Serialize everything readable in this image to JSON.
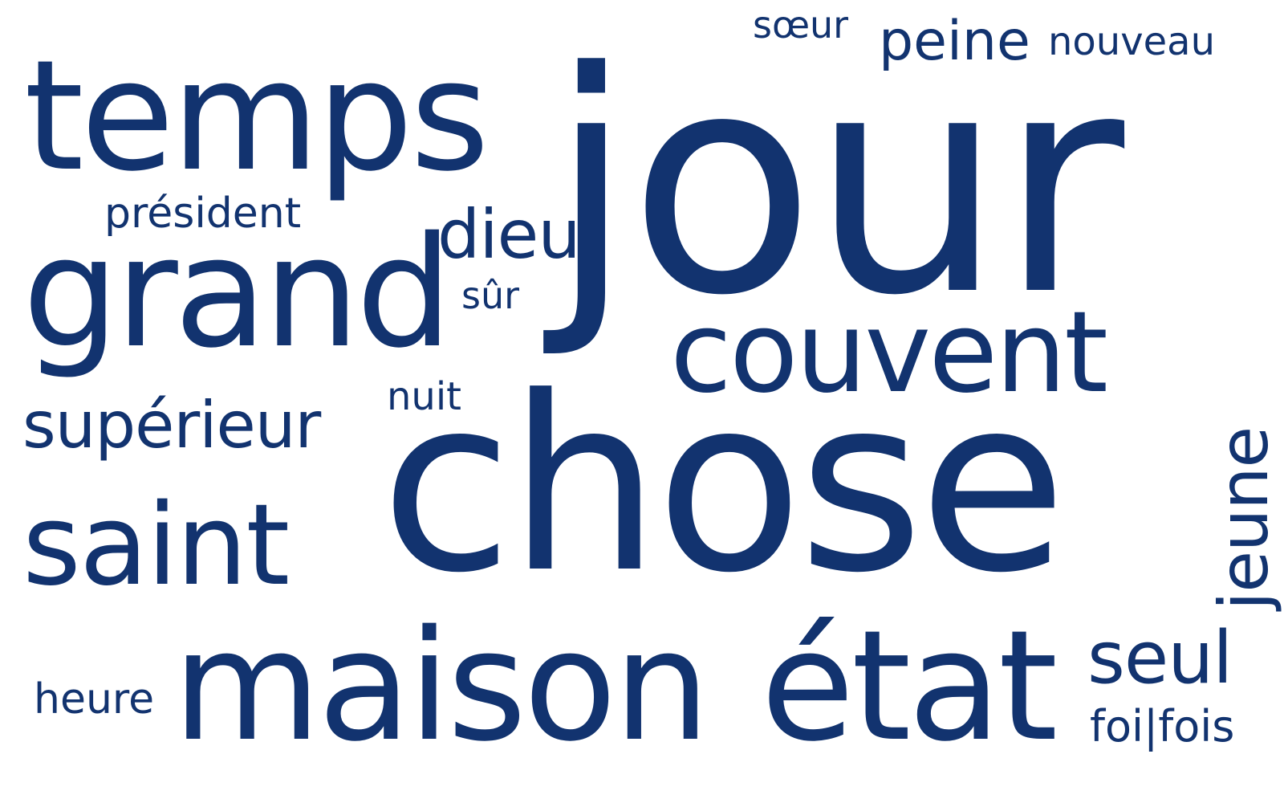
{
  "colors": {
    "word": "#12336f",
    "background": "#ffffff"
  },
  "words": {
    "jour": "jour",
    "temps": "temps",
    "chose": "chose",
    "maison": "maison",
    "etat": "état",
    "grand": "grand",
    "saint": "saint",
    "couvent": "couvent",
    "dieu": "dieu",
    "president": "président",
    "superieur": "supérieur",
    "sur": "sûr",
    "nuit": "nuit",
    "soeur": "sœur",
    "peine": "peine",
    "nouveau": "nouveau",
    "heure": "heure",
    "seul": "seul",
    "foifois": "foi|fois",
    "jeune": "jeune"
  }
}
